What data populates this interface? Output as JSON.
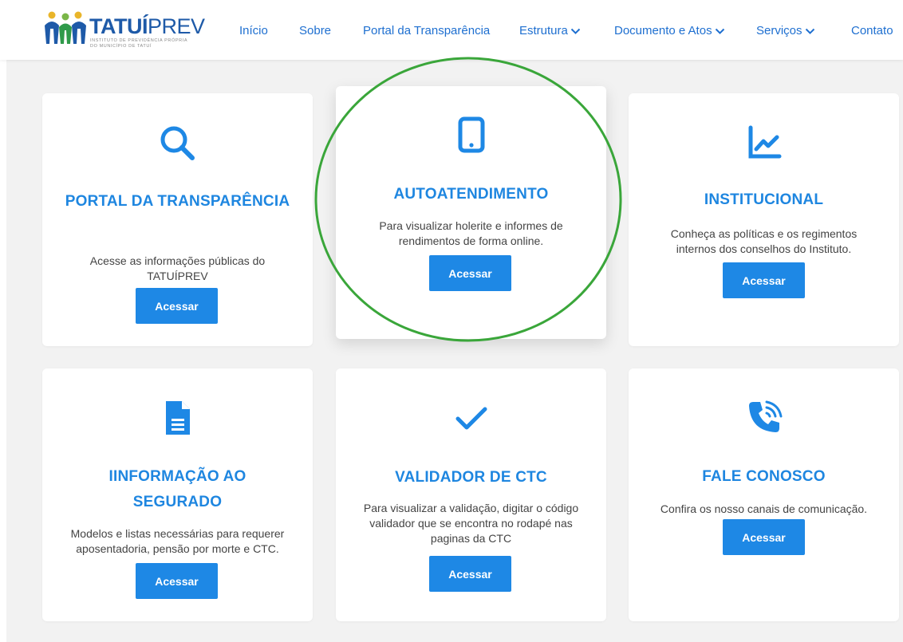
{
  "brand": {
    "name_bold": "TATUÍ",
    "name_light": "PREV",
    "subtitle": "Instituto de Previdência Própria do Município de Tatuí"
  },
  "nav": {
    "inicio": "Início",
    "sobre": "Sobre",
    "portal": "Portal da Transparência",
    "estrutura": "Estrutura",
    "documento": "Documento e Atos",
    "servicos": "Serviços",
    "contato": "Contato"
  },
  "cards": [
    {
      "title": "PORTAL DA TRANSPARÊNCIA",
      "desc": "Acesse as informações públicas do TATUÍPREV",
      "button": "Acessar",
      "icon": "search-icon"
    },
    {
      "title": "AUTOATENDIMENTO",
      "desc": "Para visualizar holerite e informes de rendimentos de forma online.",
      "button": "Acessar",
      "icon": "smartphone-icon"
    },
    {
      "title": "INSTITUCIONAL",
      "desc": "Conheça as políticas e os regimentos internos dos conselhos do Instituto.",
      "button": "Acessar",
      "icon": "chart-line-icon"
    },
    {
      "title": "IINFORMAÇÃO AO SEGURADO",
      "desc": "Modelos e listas necessárias para requerer aposentadoria, pensão por morte e CTC.",
      "button": "Acessar",
      "icon": "document-icon"
    },
    {
      "title": "VALIDADOR DE CTC",
      "desc": "Para visualizar a validação, digitar o código validador que se encontra no rodapé nas paginas da CTC",
      "button": "Acessar",
      "icon": "checkmark-icon"
    },
    {
      "title": "FALE CONOSCO",
      "desc": "Confira os nosso canais de comunicação.",
      "button": "Acessar",
      "icon": "phone-call-icon"
    }
  ],
  "colors": {
    "accent": "#1e88e5",
    "title": "#1e86e0",
    "highlight": "#3aa63a"
  }
}
